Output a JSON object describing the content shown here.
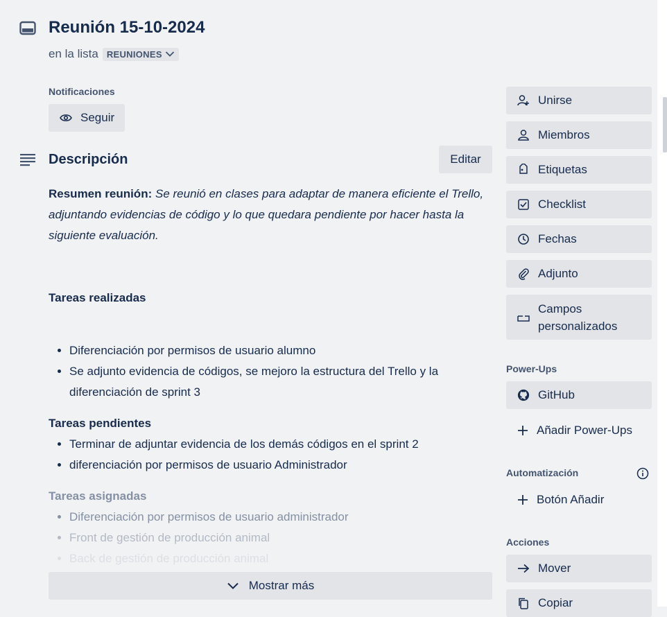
{
  "card": {
    "title": "Reunión 15-10-2024",
    "in_list_prefix": "en la lista",
    "list_name": "REUNIONES"
  },
  "notifications": {
    "label": "Notificaciones",
    "follow_label": "Seguir"
  },
  "description": {
    "title": "Descripción",
    "edit_label": "Editar",
    "summary_bold": "Resumen reunión:",
    "summary_text": "Se reunió en clases para adaptar de manera eficiente el Trello, adjuntando evidencias de código y lo que quedara pendiente por hacer hasta la siguiente evaluación.",
    "sections": [
      {
        "heading": "Tareas realizadas",
        "items": [
          "Diferenciación por permisos de usuario alumno",
          "Se adjunto evidencia de códigos, se mejoro la estructura del Trello y la diferenciación de sprint 3"
        ]
      },
      {
        "heading": "Tareas pendientes",
        "items": [
          "Terminar de adjuntar evidencia de los demás códigos en el sprint 2",
          "diferenciación por permisos de usuario Administrador"
        ]
      },
      {
        "heading": "Tareas asignadas",
        "items": [
          "Diferenciación por permisos de usuario administrador",
          "Front de gestión de producción animal",
          "Back de gestión de producción animal"
        ]
      }
    ],
    "show_more_label": "Mostrar más"
  },
  "sidebar": {
    "add_to_card": [
      {
        "label": "Unirse",
        "icon": "user-plus-icon"
      },
      {
        "label": "Miembros",
        "icon": "user-icon"
      },
      {
        "label": "Etiquetas",
        "icon": "tag-icon"
      },
      {
        "label": "Checklist",
        "icon": "checklist-icon"
      },
      {
        "label": "Fechas",
        "icon": "clock-icon"
      },
      {
        "label": "Adjunto",
        "icon": "paperclip-icon"
      },
      {
        "label": "Campos personalizados",
        "label_line1": "Campos",
        "label_line2": "personalizados",
        "icon": "custom-fields-icon"
      }
    ],
    "powerups_label": "Power-Ups",
    "github_label": "GitHub",
    "add_powerups_label": "Añadir Power-Ups",
    "automation_label": "Automatización",
    "add_button_label": "Botón Añadir",
    "actions_label": "Acciones",
    "move_label": "Mover",
    "copy_label": "Copiar"
  },
  "colors": {
    "background": "#f1f2f4",
    "button": "#e2e4e8",
    "text": "#172b4d",
    "subtle_text": "#44546f"
  }
}
